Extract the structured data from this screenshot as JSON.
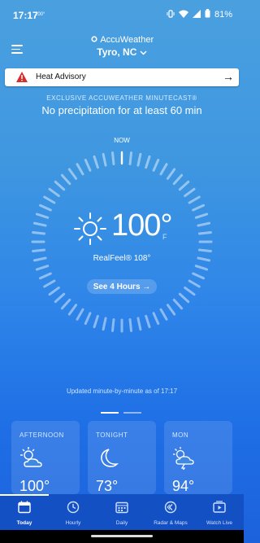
{
  "status_bar": {
    "time": "17:17",
    "small_text": "100°",
    "battery": "81%"
  },
  "header": {
    "brand": "AccuWeather",
    "location": "Tyro, NC"
  },
  "alert": {
    "label": "Heat Advisory"
  },
  "minutecast": {
    "title": "EXCLUSIVE ACCUWEATHER MINUTECAST®",
    "text": "No precipitation for at least 60 min"
  },
  "dial": {
    "now_label": "NOW"
  },
  "current": {
    "temp": "100°",
    "unit": "F",
    "realfeel": "RealFeel® 108°",
    "hours_button": "See 4 Hours →"
  },
  "updated": "Updated minute-by-minute as of 17:17",
  "forecast": [
    {
      "label": "AFTERNOON",
      "temp": "100°",
      "icon": "partly-cloudy-icon"
    },
    {
      "label": "TONIGHT",
      "temp": "73°",
      "icon": "moon-icon"
    },
    {
      "label": "MON",
      "temp": "94°",
      "icon": "thunderstorm-icon"
    }
  ],
  "nav": [
    {
      "label": "Today",
      "icon": "calendar-icon",
      "active": true
    },
    {
      "label": "Hourly",
      "icon": "clock-icon",
      "active": false
    },
    {
      "label": "Daily",
      "icon": "calendar-grid-icon",
      "active": false
    },
    {
      "label": "Radar & Maps",
      "icon": "radar-icon",
      "active": false
    },
    {
      "label": "Watch Live",
      "icon": "video-icon",
      "active": false
    }
  ],
  "colors": {
    "accent": "#1c62dc",
    "nav_bg": "#1350c4",
    "alert_icon": "#d32f2f"
  }
}
